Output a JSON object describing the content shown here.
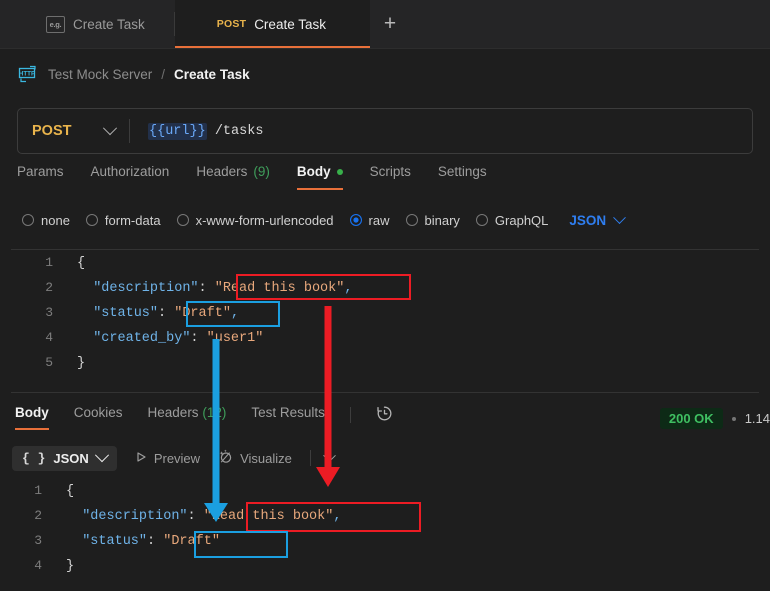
{
  "window": {
    "accent_orange": "#e8703a",
    "background": "#1e1e1e"
  },
  "tabstrip": {
    "tabs": [
      {
        "label": "Create Task",
        "icon": "example-icon",
        "icon_text": "e.g.",
        "active": false
      },
      {
        "label": "Create Task",
        "method": "POST",
        "active": true
      }
    ],
    "new_tab_label": "+"
  },
  "breadcrumb": {
    "icon": "http-mock-server-icon",
    "icon_text": "HTTP",
    "root": "Test Mock Server",
    "separator": "/",
    "leaf": "Create Task"
  },
  "request": {
    "method": "POST",
    "url_variable": "{{url}}",
    "url_path": " /tasks",
    "tabs": [
      {
        "label": "Params",
        "active": false
      },
      {
        "label": "Authorization",
        "active": false
      },
      {
        "label": "Headers",
        "count": "(9)",
        "active": false
      },
      {
        "label": "Body",
        "active": true,
        "dot": true
      },
      {
        "label": "Scripts",
        "active": false
      },
      {
        "label": "Settings",
        "active": false
      }
    ],
    "body_types": [
      {
        "label": "none",
        "checked": false
      },
      {
        "label": "form-data",
        "checked": false
      },
      {
        "label": "x-www-form-urlencoded",
        "checked": false
      },
      {
        "label": "raw",
        "checked": true
      },
      {
        "label": "binary",
        "checked": false
      },
      {
        "label": "GraphQL",
        "checked": false
      }
    ],
    "format_select": "JSON",
    "body_code": [
      {
        "num": "1",
        "rail": false,
        "tokens": [
          {
            "t": "{",
            "c": "p"
          }
        ]
      },
      {
        "num": "2",
        "rail": true,
        "tokens": [
          {
            "t": "  \"description\"",
            "c": "k"
          },
          {
            "t": ": ",
            "c": "p"
          },
          {
            "t": "\"Read this book\"",
            "c": "s"
          },
          {
            "t": ",",
            "c": "c"
          }
        ]
      },
      {
        "num": "3",
        "rail": true,
        "tokens": [
          {
            "t": "  \"status\"",
            "c": "k"
          },
          {
            "t": ": ",
            "c": "p"
          },
          {
            "t": "\"Draft\"",
            "c": "s"
          },
          {
            "t": ",",
            "c": "c"
          }
        ]
      },
      {
        "num": "4",
        "rail": true,
        "tokens": [
          {
            "t": "  \"created_by\"",
            "c": "k"
          },
          {
            "t": ": ",
            "c": "p"
          },
          {
            "t": "\"user1\"",
            "c": "s"
          }
        ]
      },
      {
        "num": "5",
        "rail": false,
        "tokens": [
          {
            "t": "}",
            "c": "p"
          }
        ]
      }
    ]
  },
  "response": {
    "tabs": [
      {
        "label": "Body",
        "active": true
      },
      {
        "label": "Cookies",
        "active": false
      },
      {
        "label": "Headers",
        "count": "(12)",
        "active": false
      },
      {
        "label": "Test Results",
        "active": false
      }
    ],
    "history_icon": "clock-history-icon",
    "status": "200 OK",
    "time": "1.14",
    "toolbar": {
      "format": "JSON",
      "format_icon": "curly-braces-icon",
      "preview_label": "Preview",
      "preview_icon": "play-triangle-icon",
      "visualize_label": "Visualize",
      "visualize_icon": "magic-wand-icon"
    },
    "body_code": [
      {
        "num": "1",
        "rail": false,
        "tokens": [
          {
            "t": "{",
            "c": "p"
          }
        ]
      },
      {
        "num": "2",
        "rail": true,
        "tokens": [
          {
            "t": "  \"description\"",
            "c": "k"
          },
          {
            "t": ": ",
            "c": "p"
          },
          {
            "t": "\"Read this book\"",
            "c": "s"
          },
          {
            "t": ",",
            "c": "c"
          }
        ]
      },
      {
        "num": "3",
        "rail": true,
        "tokens": [
          {
            "t": "  \"status\"",
            "c": "k"
          },
          {
            "t": ": ",
            "c": "p"
          },
          {
            "t": "\"Draft\"",
            "c": "s"
          }
        ]
      },
      {
        "num": "4",
        "rail": false,
        "tokens": [
          {
            "t": "}",
            "c": "p"
          }
        ]
      }
    ]
  },
  "annotations": {
    "red_color": "#ec1c24",
    "blue_color": "#1b9fe0",
    "red_label": "description-value-highlight",
    "blue_label": "status-value-highlight"
  }
}
